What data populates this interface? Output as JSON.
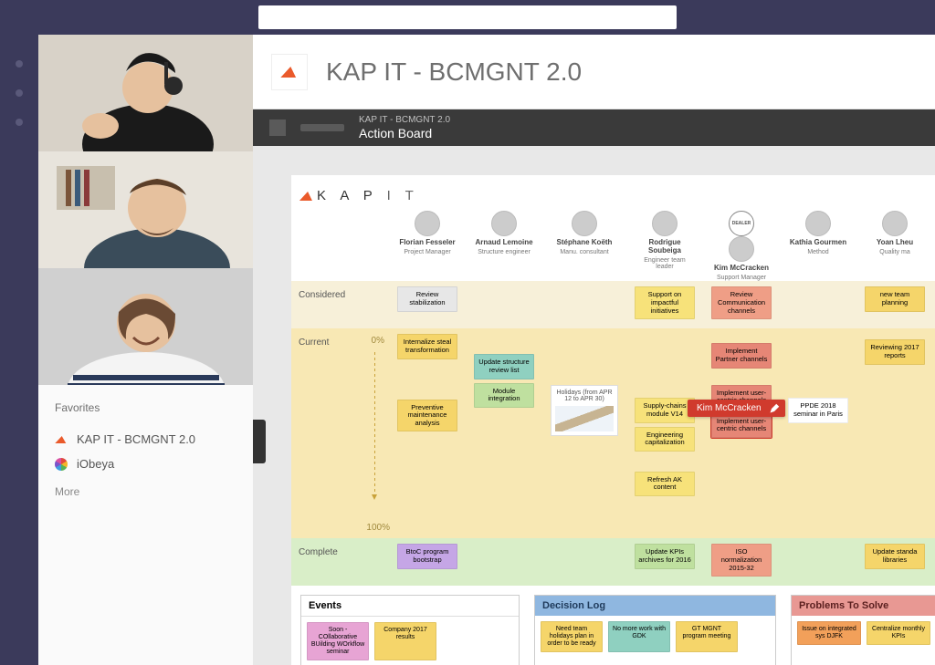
{
  "tab": {
    "title": "KAP IT - BCMGNT 2.0"
  },
  "sidebar": {
    "favorites_label": "Favorites",
    "items": [
      {
        "label": "KAP IT - BCMGNT 2.0"
      },
      {
        "label": "iObeya"
      }
    ],
    "more_label": "More"
  },
  "board": {
    "crumb": "KAP IT - BCMGNT 2.0",
    "title": "Action Board",
    "brand": "K A P I T",
    "lanes": {
      "considered": "Considered",
      "current": "Current",
      "complete": "Complete",
      "pct0": "0%",
      "pct100": "100%"
    },
    "people": [
      {
        "name": "Florian Fesseler",
        "role": "Project Manager"
      },
      {
        "name": "Arnaud Lemoine",
        "role": "Structure engineer"
      },
      {
        "name": "Stéphane Koëth",
        "role": "Manu. consultant"
      },
      {
        "name": "Rodrigue Soubeiga",
        "role": "Engineer team leader"
      },
      {
        "name": "Kim McCracken",
        "role": "Support Manager",
        "dealer": "DEALER"
      },
      {
        "name": "Kathia Gourmen",
        "role": "Method"
      },
      {
        "name": "Yoan Lheu",
        "role": "Quality ma"
      }
    ],
    "cards": {
      "florian": {
        "considered": "Review stabilization",
        "c1": "Internalize steal transformation",
        "c2": "Preventive maintenance analysis",
        "complete": "BtoC program bootstrap"
      },
      "arnaud": {
        "c1": "Update structure review list",
        "c2": "Module integration"
      },
      "stephane": {
        "holiday": "Holidays (from APR 12 to APR 30)"
      },
      "rodrigue": {
        "considered": "Support on impactful initiatives",
        "c1": "Supply-chains module V14",
        "c2": "Engineering capitalization",
        "c3": "Refresh AK content",
        "complete": "Update KPIs archives for 2016"
      },
      "kim": {
        "considered": "Review Communication channels",
        "c1": "Implement Partner channels",
        "c2": "Implement user-centric channels",
        "c3": "Implement user-centric channels",
        "complete": "ISO normalization 2015-32"
      },
      "kathia": {
        "c1": "PPDE 2018 seminar in Paris"
      },
      "yoan": {
        "considered": "new team planning",
        "c1": "Reviewing 2017 reports",
        "complete": "Update standa libraries"
      }
    },
    "cursor_user": "Kim McCracken",
    "panels": {
      "events": {
        "title": "Events",
        "items": [
          "Soon - COllaborative BUilding WOrkflow seminar",
          "Company 2017 results"
        ]
      },
      "decision": {
        "title": "Decision Log",
        "items": [
          "Need team holidays plan in order to be ready",
          "No more work with GDK",
          "GT MGNT program meeting"
        ]
      },
      "problems": {
        "title": "Problems To Solve",
        "items": [
          "Issue on integrated sys DJFK",
          "Centralize monthly KPIs"
        ]
      }
    }
  }
}
